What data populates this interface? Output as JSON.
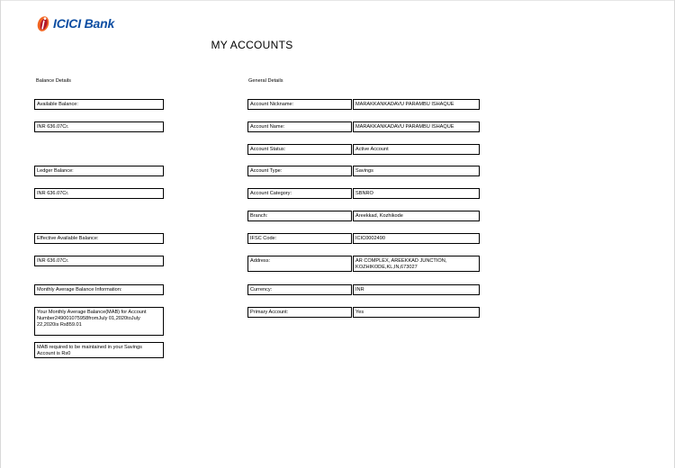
{
  "header": {
    "logo_icici": "ICICI",
    "logo_bank": "Bank",
    "title": "MY ACCOUNTS"
  },
  "balance_details": {
    "heading": "Balance Details",
    "available_balance_label": "Available Balance:",
    "available_balance_value": "INR 636.07Cr.",
    "ledger_balance_label": "Ledger Balance:",
    "ledger_balance_value": "INR 636.07Cr.",
    "effective_balance_label": "Effective Available Balance:",
    "effective_balance_value": "INR 636.07Cr.",
    "mab_info_label": "Monthly Average Balance Information:",
    "mab_info_text": "Your Monthly Average Balance(MAB) for Account Number249001075958fromJuly 01,2020toJuly 22,2020is Rs859.01",
    "mab_required_text": "MAB required to be maintained in your Savings Account is Rs0"
  },
  "general_details": {
    "heading": "General Details",
    "rows": [
      {
        "label": "Account Nickname:",
        "value": "MARAKKANKADAVU PARAMBU ISHAQUE"
      },
      {
        "label": "Account Name:",
        "value": "MARAKKANKADAVU PARAMBU ISHAQUE"
      },
      {
        "label": "Account Status:",
        "value": "Active Account"
      },
      {
        "label": "Account Type:",
        "value": "Savings"
      },
      {
        "label": "Account Category:",
        "value": "SBNRO"
      },
      {
        "label": "Branch:",
        "value": "Areekkad, Kozhikode"
      },
      {
        "label": "IFSC Code:",
        "value": "ICIC0002490"
      },
      {
        "label": "Address:",
        "value": "AR COMPLEX, AREEKKAD JUNCTION, KOZHIKODE,KL,IN,673027"
      },
      {
        "label": "Currency:",
        "value": "INR"
      },
      {
        "label": "Primary Account:",
        "value": "Yes"
      }
    ]
  },
  "colors": {
    "brand_blue": "#0c4da2",
    "brand_orange": "#f26522",
    "brand_red": "#b2182b"
  }
}
